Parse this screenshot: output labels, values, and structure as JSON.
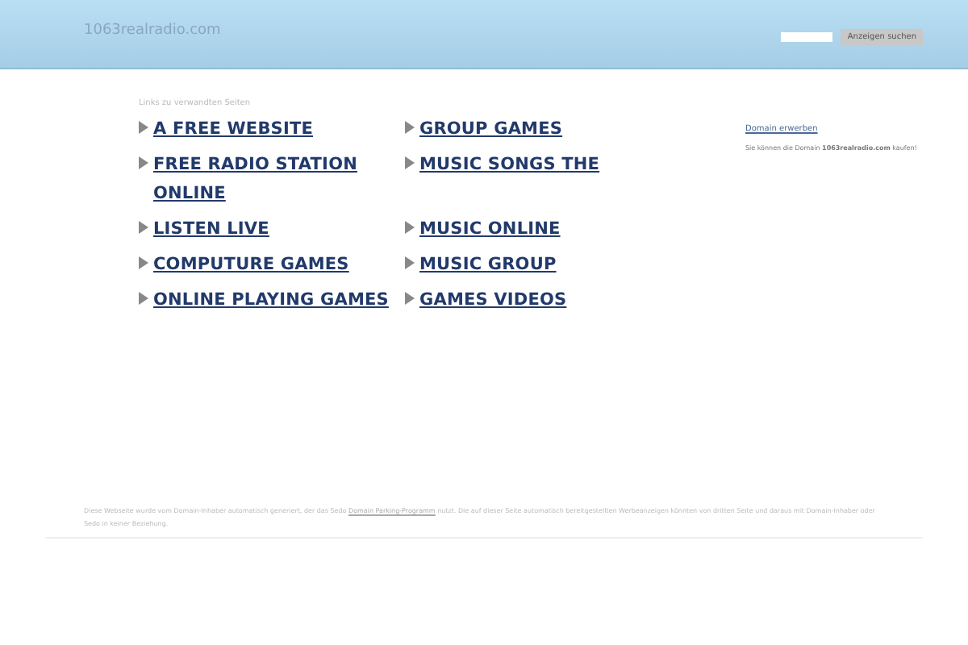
{
  "header": {
    "site_name": "1063realradio.com",
    "search_button": "Anzeigen suchen"
  },
  "links_heading": "Links zu verwandten Seiten",
  "links": [
    {
      "label": "A FREE WEBSITE"
    },
    {
      "label": "GROUP GAMES"
    },
    {
      "label": "FREE RADIO STATION ONLINE"
    },
    {
      "label": "MUSIC SONGS THE"
    },
    {
      "label": "LISTEN LIVE"
    },
    {
      "label": "MUSIC ONLINE"
    },
    {
      "label": "COMPUTURE GAMES"
    },
    {
      "label": "MUSIC GROUP"
    },
    {
      "label": "ONLINE PLAYING GAMES"
    },
    {
      "label": "GAMES VIDEOS"
    }
  ],
  "sidebar": {
    "link": "Domain erwerben",
    "text": "Sie können die Domain **1063realradio.com** kaufen!"
  },
  "footer": {
    "text_before": "Diese Webseite wurde vom Domain-Inhaber automatisch generiert, der das Sedo",
    "link": "Domain Parking-Programm",
    "text_after": "nutzt. Die auf dieser Seite automatisch bereitgestellten Werbeanzeigen könnten von dritten Seite und daraus mit Domain-Inhaber oder Sedo in keiner Beziehung."
  }
}
